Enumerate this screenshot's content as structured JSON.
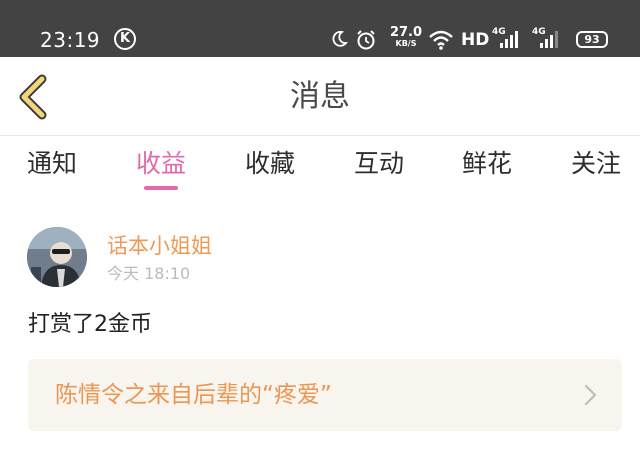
{
  "status_bar": {
    "time": "23:19",
    "k_badge": "K",
    "net_speed_value": "27.0",
    "net_speed_unit": "KB/S",
    "hd_label": "HD",
    "signal1_label": "4G",
    "signal2_label": "4G",
    "battery": "93",
    "icons": [
      "moon-icon",
      "alarm-icon",
      "wifi-icon",
      "signal-icon",
      "battery-icon"
    ]
  },
  "header": {
    "title": "消息",
    "back_icon": "chevron-left-icon"
  },
  "tabs": [
    {
      "label": "通知",
      "active": false
    },
    {
      "label": "收益",
      "active": true
    },
    {
      "label": "收藏",
      "active": false
    },
    {
      "label": "互动",
      "active": false
    },
    {
      "label": "鲜花",
      "active": false
    },
    {
      "label": "关注",
      "active": false
    }
  ],
  "message": {
    "username": "话本小姐姐",
    "time": "今天 18:10",
    "text": "打赏了2金币",
    "card_title": "陈情令之来自后辈的“疼爱”",
    "card_icon": "chevron-right-icon"
  },
  "colors": {
    "status_bg": "#434343",
    "accent_pink": "#e36aa8",
    "accent_orange": "#ec9653",
    "back_chevron": "#f2d77a",
    "card_bg": "#f7f5ee"
  }
}
